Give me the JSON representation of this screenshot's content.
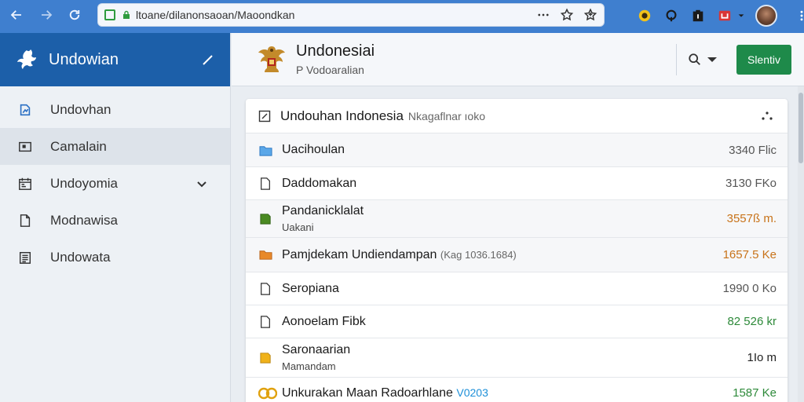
{
  "browser": {
    "url": "ltoane/dilanonsaoan/Maoondkan",
    "icons": [
      "back-icon",
      "forward-icon",
      "reload-icon",
      "more-icon",
      "bookmark-star-icon",
      "reading-list-icon"
    ]
  },
  "sidebar": {
    "title": "Undowian",
    "items": [
      {
        "label": "Undovhan",
        "icon": "chart-doc-icon"
      },
      {
        "label": "Camalain",
        "icon": "card-icon"
      },
      {
        "label": "Undoyomia",
        "icon": "calendar-icon"
      },
      {
        "label": "Modnawisa",
        "icon": "page-icon"
      },
      {
        "label": "Undowata",
        "icon": "list-doc-icon"
      }
    ]
  },
  "header": {
    "title": "Undonesiai",
    "subtitle": "P Vodoaralian",
    "primary_button": "Slentiv"
  },
  "card": {
    "title": "Undouhan Indonesia",
    "meta": "Nkagaflnar ıoko",
    "rows": [
      {
        "name": "Uacihoulan",
        "size": "3340 Flic",
        "icon": "folder-blue-icon",
        "size_color": "#555555"
      },
      {
        "name": "Daddomakan",
        "size": "3130 FKo",
        "icon": "doc-icon",
        "size_color": "#555555"
      },
      {
        "name": "Pandanicklalat",
        "sub": "Uakani",
        "size": "3557ß m.",
        "icon": "folder-green-icon",
        "size_color": "#c8731a"
      },
      {
        "name": "Pamjdekam Undiendampan",
        "meta": "(Kag 1036.1684)",
        "size": "1657.5 Ke",
        "icon": "folder-orange-icon",
        "size_color": "#c8731a"
      },
      {
        "name": "Seropiana",
        "size": "1990 0 Ko",
        "icon": "doc-icon",
        "size_color": "#555555"
      },
      {
        "name": "Aonoelam Fibk",
        "size": "82 526 kr",
        "icon": "doc-icon",
        "size_color": "#2e8a3a"
      },
      {
        "name": "Saronaarian",
        "sub": "Mamandam",
        "size": "1Io m",
        "icon": "folder-yellow-icon",
        "size_color": "#222222"
      },
      {
        "name": "Unkurakan Maan Radoarhlane",
        "link": "V0203",
        "size": "1587 Ke",
        "icon": "co-badge-icon",
        "size_color": "#2e8a3a"
      }
    ]
  }
}
